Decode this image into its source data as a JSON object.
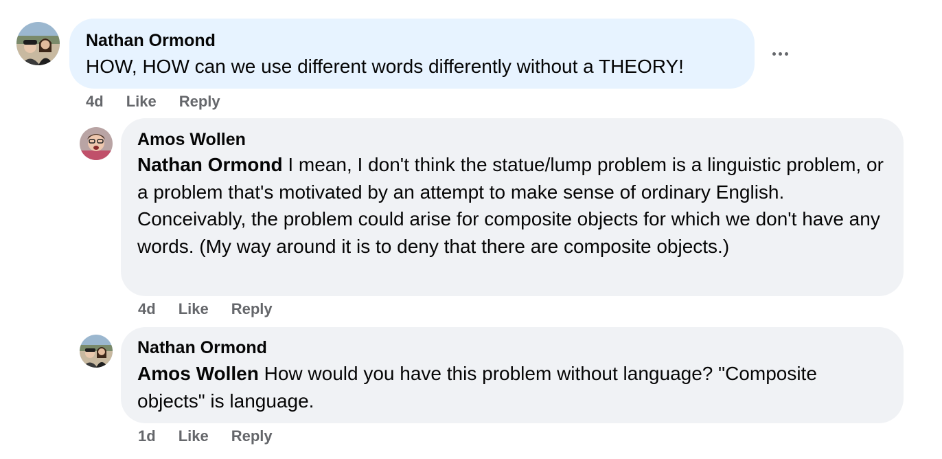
{
  "comments": [
    {
      "author": "Nathan Ormond",
      "text": "HOW, HOW can we use different words differently without a THEORY!",
      "time": "4d",
      "like_label": "Like",
      "reply_label": "Reply"
    },
    {
      "author": "Amos Wollen",
      "mention": "Nathan Ormond",
      "text": " I mean, I don't think the statue/lump problem is a linguistic problem, or a problem that's motivated by an attempt to make sense of ordinary English. Conceivably, the problem could arise for composite objects for which we don't have any words. (My way around it is to deny that there are composite objects.)",
      "time": "4d",
      "like_label": "Like",
      "reply_label": "Reply"
    },
    {
      "author": "Nathan Ormond",
      "mention": "Amos Wollen",
      "text": " How would you have this problem without language? \"Composite objects\" is language.",
      "time": "1d",
      "like_label": "Like",
      "reply_label": "Reply"
    }
  ],
  "more_icon": "more-horizontal-icon",
  "colors": {
    "highlight_bubble": "#e7f3ff",
    "bubble": "#f0f2f5",
    "meta_text": "#65676b"
  }
}
